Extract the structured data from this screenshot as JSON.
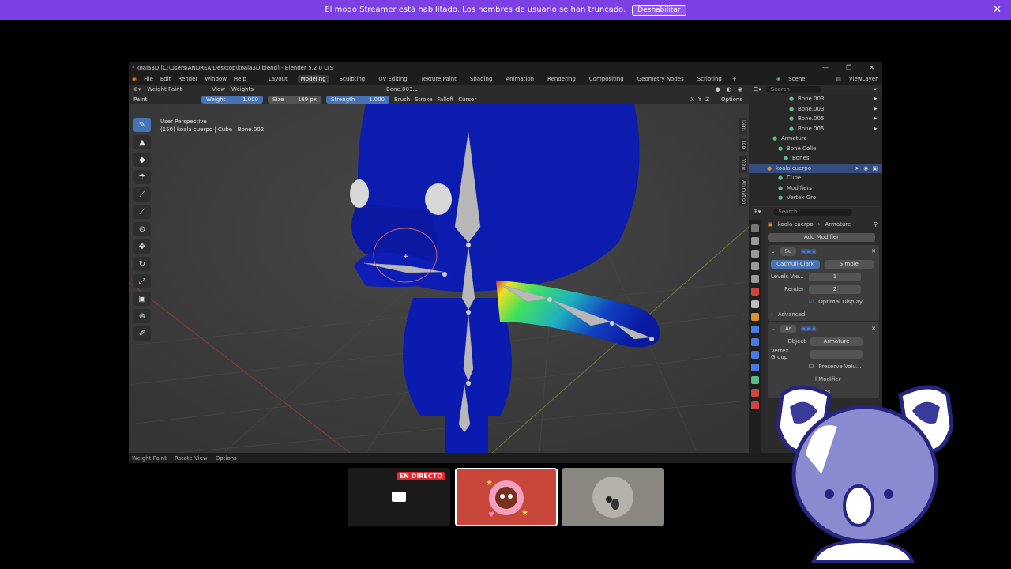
{
  "banner": {
    "message": "El modo Streamer está habilitado. Los nombres de usuario se han truncado.",
    "button": "Deshabilitar",
    "close": "✕"
  },
  "window": {
    "title": "* koala3D [C:\\Users\\ANDREA\\Desktop\\koala3D.blend] - Blender 5.2.0 LTS",
    "menus": [
      "File",
      "Edit",
      "Render",
      "Window",
      "Help"
    ],
    "workspaces": [
      "Layout",
      "Modeling",
      "Sculpting",
      "UV Editing",
      "Texture Paint",
      "Shading",
      "Animation",
      "Rendering",
      "Compositing",
      "Geometry Nodes",
      "Scripting"
    ],
    "active_workspace": "Modeling",
    "scene": "Scene",
    "view_layer": "ViewLayer"
  },
  "viewport": {
    "mode": "Weight Paint",
    "menus": [
      "View",
      "Weights"
    ],
    "bone": "Bone.003.L",
    "tool": {
      "brush_name": "Paint",
      "weight_label": "Weight",
      "weight_value": "1.000",
      "size_label": "Size",
      "size_value": "169 px",
      "strength_label": "Strength",
      "strength_value": "1.000",
      "brush": "Brush",
      "stroke": "Stroke",
      "falloff": "Falloff",
      "cursor": "Cursor",
      "options": "Options"
    },
    "info_line1": "User Perspective",
    "info_line2": "(150) koala cuerpo | Cube : Bone.002",
    "side_tabs": [
      "Item",
      "Tool",
      "View",
      "Animation"
    ],
    "axes": [
      "X",
      "Y",
      "Z"
    ]
  },
  "statusbar": {
    "items": [
      "Weight Paint",
      "Rotate View",
      "Options"
    ]
  },
  "outliner": {
    "search_placeholder": "Search",
    "rows": [
      {
        "indent": 7,
        "icon": "bone-icon",
        "label": "Bone.003.",
        "sel": false
      },
      {
        "indent": 7,
        "icon": "bone-icon",
        "label": "Bone.003.",
        "sel": false
      },
      {
        "indent": 7,
        "icon": "bone-icon",
        "label": "Bone.005.",
        "sel": false
      },
      {
        "indent": 7,
        "icon": "bone-icon",
        "label": "Bone.005.",
        "sel": false
      },
      {
        "indent": 4,
        "icon": "armature-icon",
        "label": "Armature",
        "sel": false
      },
      {
        "indent": 5,
        "icon": "bone-collection-icon",
        "label": "Bone Colle",
        "sel": false
      },
      {
        "indent": 6,
        "icon": "bones-icon",
        "label": "Bones",
        "sel": false
      },
      {
        "indent": 3,
        "icon": "mesh-object-icon",
        "label": "koala cuerpo",
        "sel": true
      },
      {
        "indent": 5,
        "icon": "mesh-data-icon",
        "label": "Cube",
        "sel": false
      },
      {
        "indent": 5,
        "icon": "modifier-icon",
        "label": "Modifiers",
        "sel": false
      },
      {
        "indent": 5,
        "icon": "vertex-group-icon",
        "label": "Vertex Gro",
        "sel": false
      }
    ]
  },
  "properties": {
    "search_placeholder": "Search",
    "breadcrumb_object": "koala cuerpo",
    "breadcrumb_modifier": "Armature",
    "add_modifier": "Add Modifier",
    "subsurf": {
      "name": "Su",
      "tab_catmull": "Catmull-Clark",
      "tab_simple": "Simple",
      "levels_label": "Levels Vie...",
      "levels_value": "1",
      "render_label": "Render",
      "render_value": "2",
      "optimal_label": "Optimal Display",
      "advanced": "Advanced"
    },
    "armature_mod": {
      "name": "Ar",
      "object_label": "Object",
      "object_value": "Armature",
      "vgroup_label": "Vertex Group",
      "preserve": "Preserve Volu...",
      "multi": "l Modifier",
      "groups": "roups"
    }
  },
  "thumbnails": {
    "live_label": "EN DIRECTO"
  },
  "colors": {
    "banner": "#7b3fe4",
    "accent": "#4772b3",
    "koala_body": "#0a1aa0",
    "live": "#e0262c"
  }
}
